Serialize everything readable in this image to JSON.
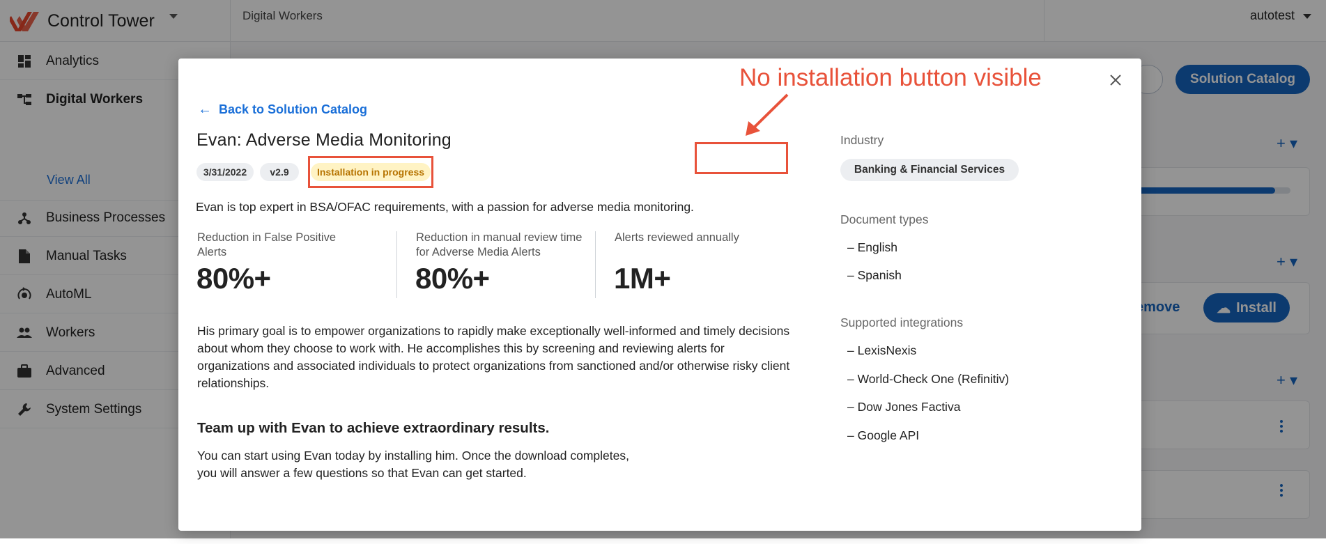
{
  "app": {
    "title": "Control Tower",
    "breadcrumb": "Digital Workers",
    "user": "autotest",
    "accent": "#1565c0"
  },
  "sidebar": {
    "items": [
      {
        "label": "Analytics",
        "icon": "dashboard-icon"
      },
      {
        "label": "Digital Workers",
        "icon": "hierarchy-icon"
      },
      {
        "label": "Business Processes",
        "icon": "process-icon"
      },
      {
        "label": "Manual Tasks",
        "icon": "document-icon"
      },
      {
        "label": "AutoML",
        "icon": "automl-icon"
      },
      {
        "label": "Workers",
        "icon": "people-icon"
      },
      {
        "label": "Advanced",
        "icon": "briefcase-icon"
      },
      {
        "label": "System Settings",
        "icon": "wrench-icon"
      }
    ],
    "sub_item": "View All"
  },
  "background": {
    "catalog_button": "Solution Catalog",
    "remove_label": "emove",
    "install_label": "Install",
    "progress_fraction": 0.9
  },
  "modal": {
    "back_link": "Back to Solution Catalog",
    "title": "Evan: Adverse Media Monitoring",
    "date": "3/31/2022",
    "version": "v2.9",
    "status": "Installation in progress",
    "intro": "Evan is top expert in BSA/OFAC requirements, with a passion for adverse media monitoring.",
    "stats": [
      {
        "label": "Reduction in False Positive Alerts",
        "value": "80%+"
      },
      {
        "label": "Reduction in manual review time for Adverse Media Alerts",
        "value": "80%+"
      },
      {
        "label": "Alerts reviewed annually",
        "value": "1M+"
      }
    ],
    "body": "His primary goal is to empower organizations to rapidly make exceptionally well-informed and timely decisions about whom they choose to work with. He accomplishes this by screening and reviewing alerts for organizations and associated individuals to protect organizations from sanctioned and/or otherwise risky client relationships.",
    "team_title": "Team up with Evan to achieve extraordinary results.",
    "team_body": "You can start using Evan today by installing him. Once the download completes, you will answer a few questions so that Evan can get started.",
    "industry_heading": "Industry",
    "industry": "Banking & Financial Services",
    "doc_types_heading": "Document types",
    "doc_types": [
      "– English",
      "– Spanish"
    ],
    "integrations_heading": "Supported integrations",
    "integrations": [
      "– LexisNexis",
      "– World-Check One (Refinitiv)",
      "– Dow Jones Factiva",
      "– Google API"
    ]
  },
  "annotation": {
    "text": "No installation button visible",
    "color": "#e8523a"
  }
}
